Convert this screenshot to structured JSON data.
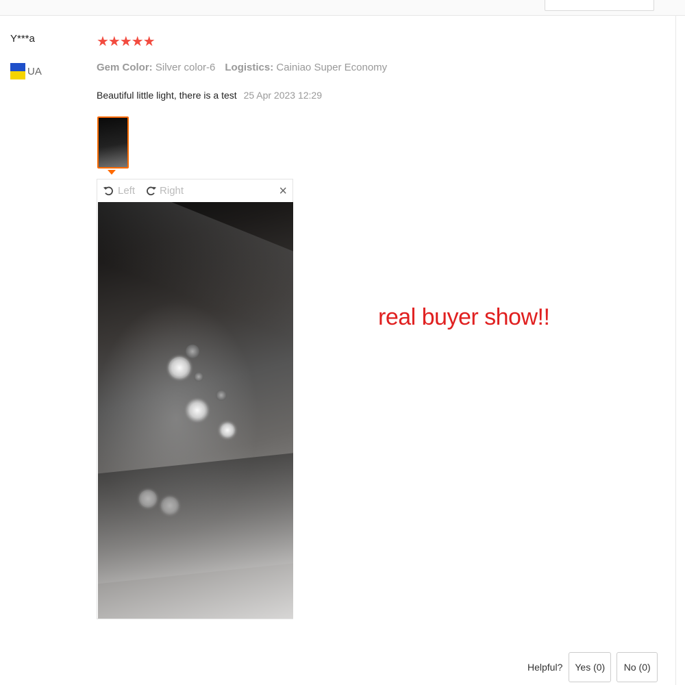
{
  "review": {
    "reviewer_name": "Y***a",
    "country_code": "UA",
    "rating_stars": "★★★★★",
    "rating": 5,
    "attributes": [
      {
        "label": "Gem Color:",
        "value": "Silver color-6"
      },
      {
        "label": "Logistics:",
        "value": "Cainiao Super Economy"
      }
    ],
    "text": "Beautiful little light, there is a test",
    "date": "25 Apr 2023 12:29"
  },
  "viewer": {
    "rotate_left_label": "Left",
    "rotate_right_label": "Right",
    "close_symbol": "×"
  },
  "promo_text": "real buyer show!!",
  "helpful": {
    "label": "Helpful?",
    "yes_label": "Yes (0)",
    "no_label": "No (0)"
  },
  "colors": {
    "accent": "#ff6a00",
    "stars": "#f24b3f",
    "promo": "#e02020"
  },
  "icons": [
    "rotate-left-icon",
    "rotate-right-icon",
    "close-icon",
    "ukraine-flag-icon"
  ]
}
